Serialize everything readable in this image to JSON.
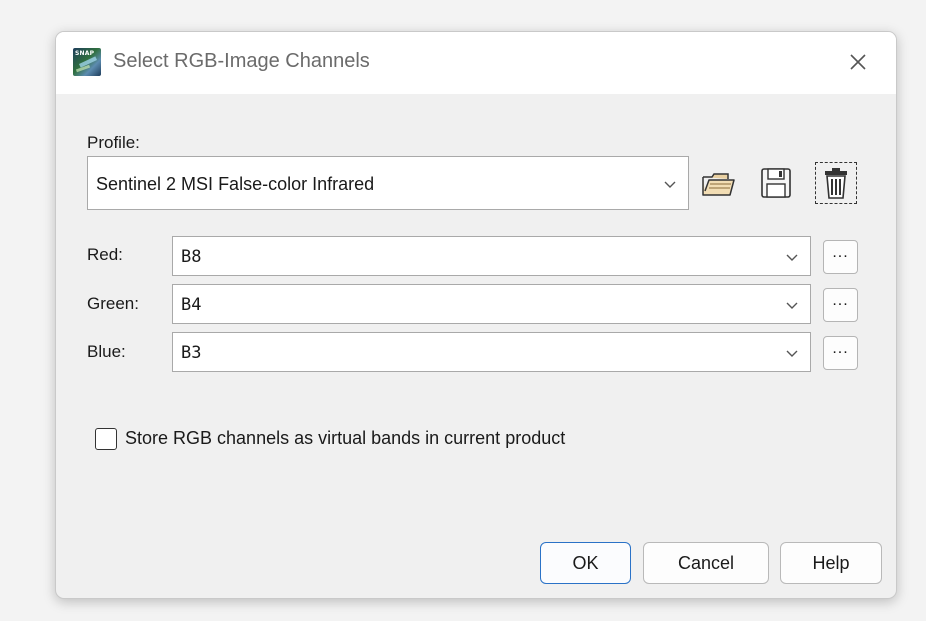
{
  "window": {
    "title": "Select RGB-Image Channels",
    "app_icon_text": "SNAP"
  },
  "profile": {
    "label": "Profile:",
    "selected": "Sentinel 2 MSI False-color Infrared",
    "icons": [
      "open-folder-icon",
      "save-floppy-icon",
      "delete-trash-icon"
    ]
  },
  "channels": [
    {
      "label": "Red:",
      "value": "B8",
      "more": "..."
    },
    {
      "label": "Green:",
      "value": "B4",
      "more": "..."
    },
    {
      "label": "Blue:",
      "value": "B3",
      "more": "..."
    }
  ],
  "option": {
    "label": "Store RGB channels as virtual bands in current product",
    "checked": false
  },
  "buttons": {
    "ok": "OK",
    "cancel": "Cancel",
    "help": "Help"
  },
  "colors": {
    "primary_button_border": "#2a72c7",
    "dialog_background": "#f0f0f0",
    "titlebar_background": "#ffffff"
  }
}
